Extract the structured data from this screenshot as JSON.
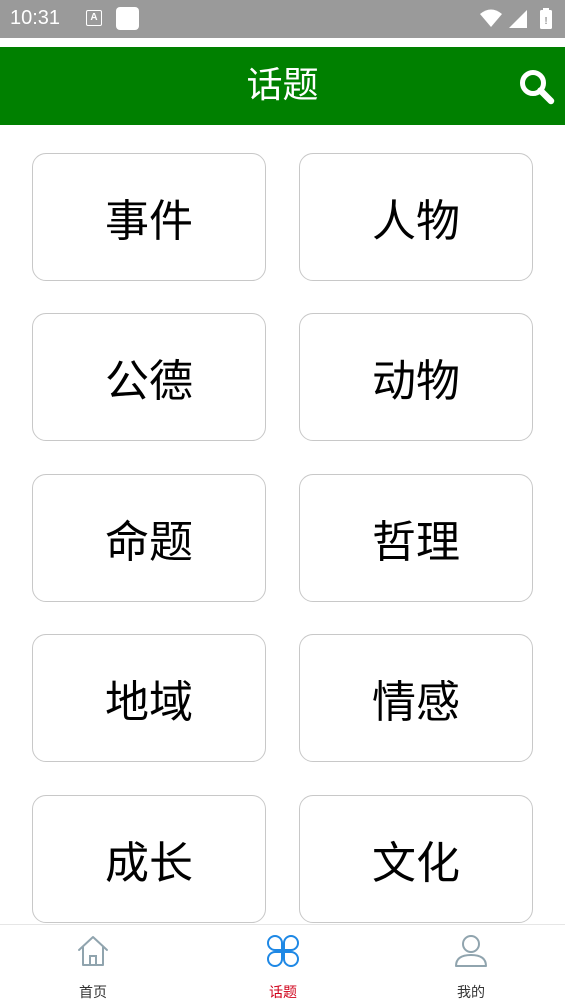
{
  "status_bar": {
    "time": "10:31",
    "notification_icon_letter": "A",
    "icons": [
      "app-notification-icon",
      "wifi-icon",
      "signal-icon",
      "battery-icon"
    ]
  },
  "header": {
    "title": "话题",
    "search_icon": "search-icon",
    "background_color": "#008000"
  },
  "topics": [
    {
      "label": "事件"
    },
    {
      "label": "人物"
    },
    {
      "label": "公德"
    },
    {
      "label": "动物"
    },
    {
      "label": "命题"
    },
    {
      "label": "哲理"
    },
    {
      "label": "地域"
    },
    {
      "label": "情感"
    },
    {
      "label": "成长"
    },
    {
      "label": "文化"
    }
  ],
  "bottom_nav": {
    "items": [
      {
        "label": "首页",
        "icon": "home-icon",
        "active": false
      },
      {
        "label": "话题",
        "icon": "clover-icon",
        "active": true
      },
      {
        "label": "我的",
        "icon": "user-icon",
        "active": false
      }
    ],
    "active_color": "#d0021b",
    "icon_active_color": "#1e88e5",
    "icon_inactive_color": "#90a4ae"
  }
}
